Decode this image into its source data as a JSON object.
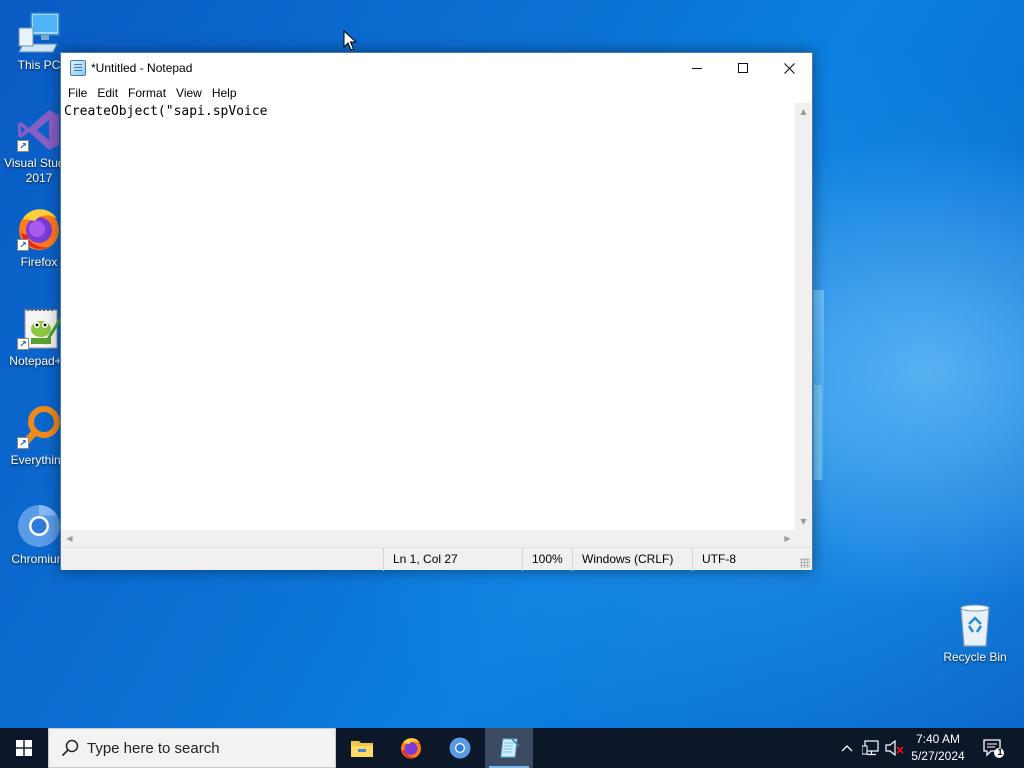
{
  "desktop": {
    "icons": [
      {
        "label": "This PC"
      },
      {
        "label": "Visual Studio 2017"
      },
      {
        "label": "Firefox"
      },
      {
        "label": "Notepad++"
      },
      {
        "label": "Everything"
      },
      {
        "label": "Chromium"
      },
      {
        "label": "Recycle Bin"
      }
    ]
  },
  "window": {
    "title": "*Untitled - Notepad",
    "minimize_glyph": "—",
    "maximize_glyph": "☐",
    "close_glyph": "✕",
    "menu": [
      "File",
      "Edit",
      "Format",
      "View",
      "Help"
    ],
    "content": "CreateObject(\"sapi.spVoice",
    "status": {
      "position": "Ln 1, Col 27",
      "zoom": "100%",
      "line_endings": "Windows (CRLF)",
      "encoding": "UTF-8"
    }
  },
  "taskbar": {
    "search_placeholder": "Type here to search",
    "apps": [
      "file-explorer-icon",
      "firefox-icon",
      "chromium-icon",
      "notepad-icon"
    ],
    "time": "7:40 AM",
    "date": "5/27/2024",
    "notification_count": "1"
  },
  "colors": {
    "taskbar": "#0c1729",
    "accent": "#0a6fd0"
  }
}
